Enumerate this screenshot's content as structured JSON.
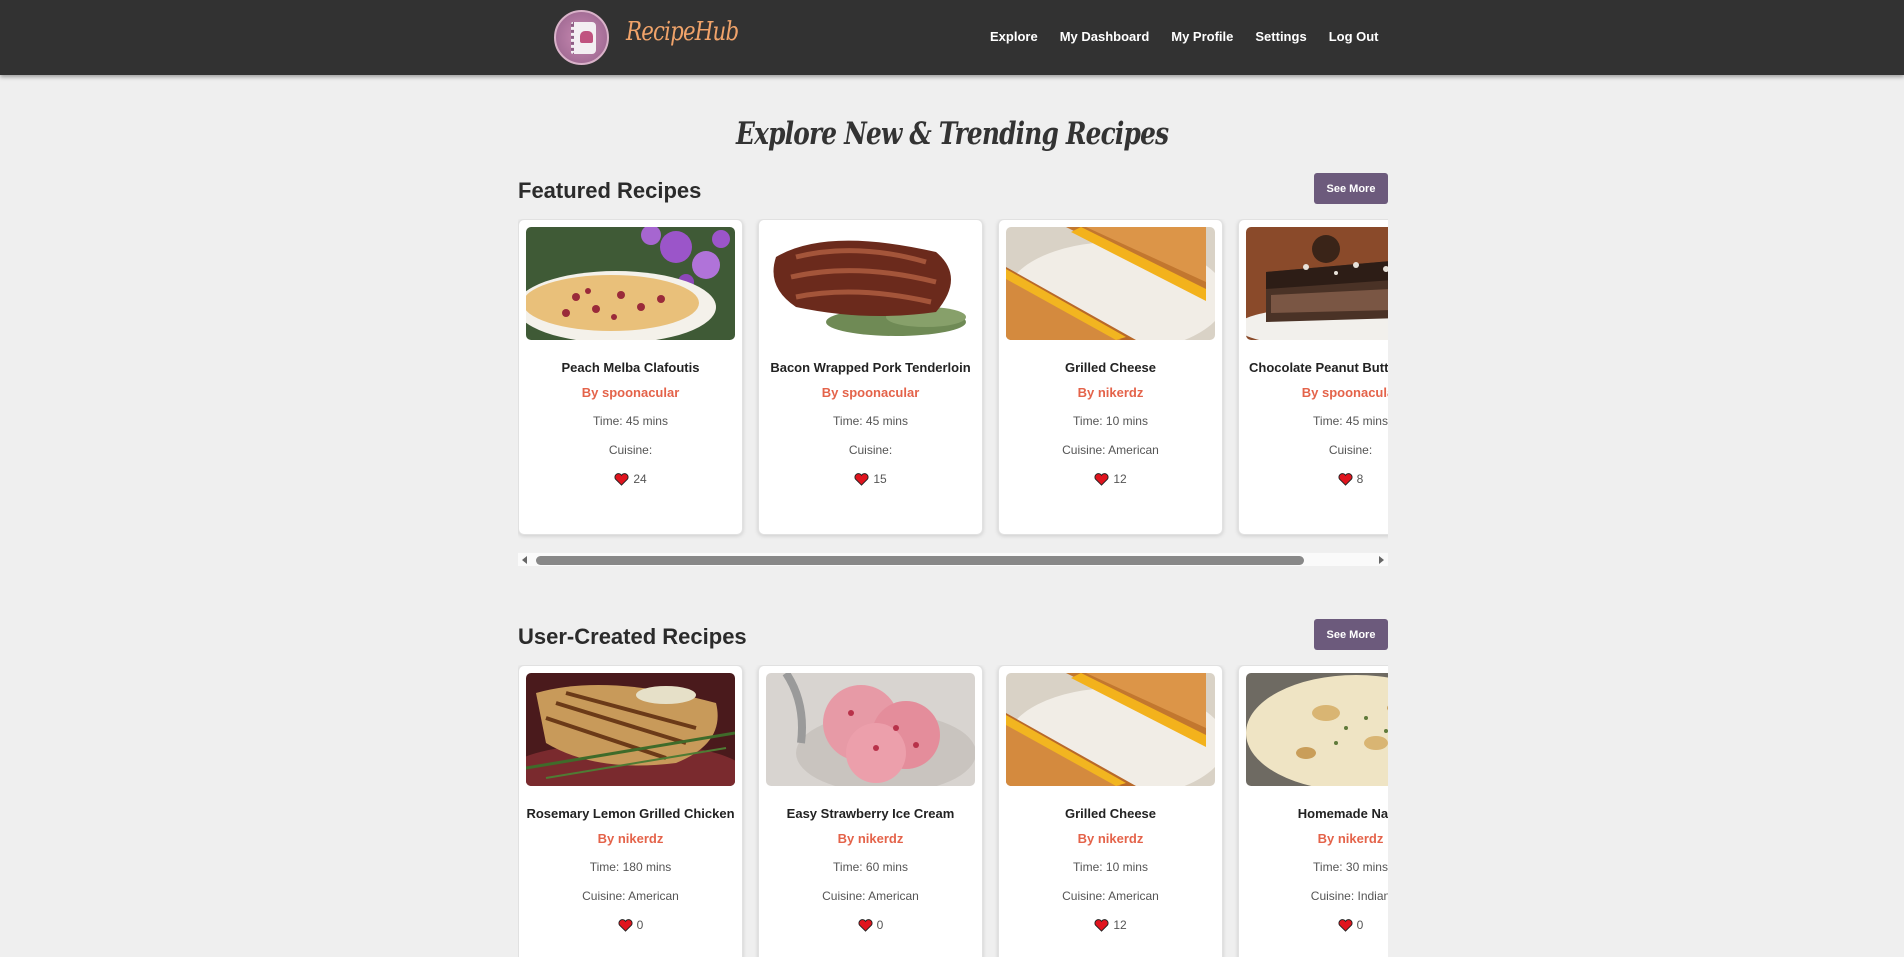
{
  "brand": {
    "name": "RecipeHub"
  },
  "nav": {
    "links": [
      {
        "label": "Explore"
      },
      {
        "label": "My Dashboard"
      },
      {
        "label": "My Profile"
      },
      {
        "label": "Settings"
      },
      {
        "label": "Log Out"
      }
    ]
  },
  "page": {
    "heading": "Explore New & Trending Recipes"
  },
  "featured": {
    "title": "Featured Recipes",
    "see_more": "See More",
    "cards": [
      {
        "title": "Peach Melba Clafoutis",
        "author": "By spoonacular",
        "time": "Time: 45 mins",
        "cuisine": "Cuisine:",
        "likes": "24",
        "image": "clafoutis-photo"
      },
      {
        "title": "Bacon Wrapped Pork Tenderloin",
        "author": "By spoonacular",
        "time": "Time: 45 mins",
        "cuisine": "Cuisine:",
        "likes": "15",
        "image": "pork-tenderloin-photo"
      },
      {
        "title": "Grilled Cheese",
        "author": "By nikerdz",
        "time": "Time: 10 mins",
        "cuisine": "Cuisine: American",
        "likes": "12",
        "image": "grilled-cheese-photo"
      },
      {
        "title": "Chocolate Peanut Butter Dessert",
        "author": "By spoonacular",
        "time": "Time: 45 mins",
        "cuisine": "Cuisine:",
        "likes": "8",
        "image": "chocolate-dessert-photo"
      }
    ]
  },
  "user_created": {
    "title": "User-Created Recipes",
    "see_more": "See More",
    "cards": [
      {
        "title": "Rosemary Lemon Grilled Chicken",
        "author": "By nikerdz",
        "time": "Time: 180 mins",
        "cuisine": "Cuisine: American",
        "likes": "0",
        "image": "grilled-chicken-photo"
      },
      {
        "title": "Easy Strawberry Ice Cream",
        "author": "By nikerdz",
        "time": "Time: 60 mins",
        "cuisine": "Cuisine: American",
        "likes": "0",
        "image": "strawberry-ice-cream-photo"
      },
      {
        "title": "Grilled Cheese",
        "author": "By nikerdz",
        "time": "Time: 10 mins",
        "cuisine": "Cuisine: American",
        "likes": "12",
        "image": "grilled-cheese-photo"
      },
      {
        "title": "Homemade Naan",
        "author": "By nikerdz",
        "time": "Time: 30 mins",
        "cuisine": "Cuisine: Indian",
        "likes": "0",
        "image": "naan-photo"
      }
    ]
  },
  "colors": {
    "navbar": "#323232",
    "brand": "#f0a36a",
    "author": "#e4634a",
    "button": "#6c5a7c",
    "heart": "#e0141e"
  },
  "icons": {
    "like": "heart-icon",
    "logo": "recipe-book-icon"
  }
}
